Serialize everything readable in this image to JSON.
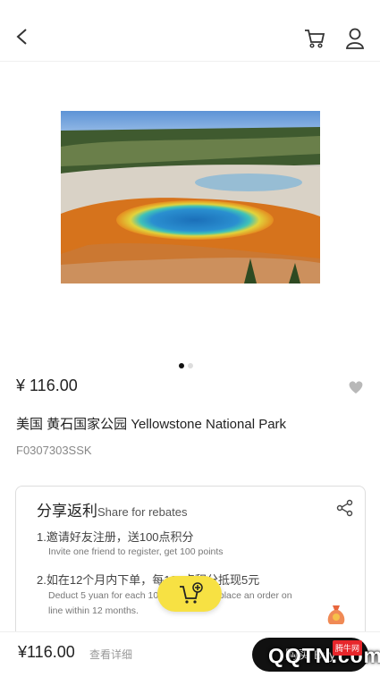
{
  "product": {
    "price": "¥ 116.00",
    "title": "美国 黄石国家公园 Yellowstone National Park",
    "sku": "F0307303SSK",
    "image_slides": 2,
    "active_slide": 1
  },
  "rebate": {
    "title_cn": "分享返利",
    "title_en": "Share for rebates",
    "rule1_cn": "1.邀请好友注册，送100点积分",
    "rule1_en": "Invite one friend to register, get 100 points",
    "rule2_cn": "2.如在12个月内下单，每100点积分抵现5元",
    "rule2_en": "Deduct 5 yuan for each 100 points if you place an order on line within 12 months."
  },
  "bottom_bar": {
    "price": "¥116.00",
    "details_label": "查看详细",
    "buy_label": "购买 Buy"
  },
  "watermark": {
    "text": "QQTN.com",
    "badge": "腾牛网"
  },
  "icons": {
    "back": "back-arrow-icon",
    "cart": "cart-icon",
    "user": "user-icon",
    "favorite": "heart-icon",
    "share": "share-icon",
    "add_to_cart": "cart-plus-icon",
    "money_bag": "money-bag-icon"
  }
}
